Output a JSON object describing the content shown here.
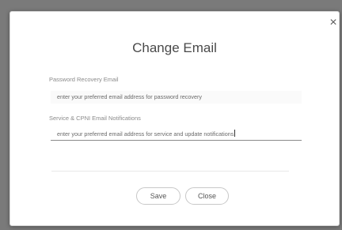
{
  "dialog": {
    "title": "Change Email",
    "close_icon": "×",
    "recovery": {
      "label": "Password Recovery Email",
      "placeholder": "enter your preferred email address for password recovery"
    },
    "notifications": {
      "label": "Service & CPNI Email Notifications",
      "placeholder": "enter your preferred email address for service and update notifications"
    },
    "save_label": "Save",
    "close_label": "Close"
  },
  "icons": {
    "close": "close-icon"
  }
}
